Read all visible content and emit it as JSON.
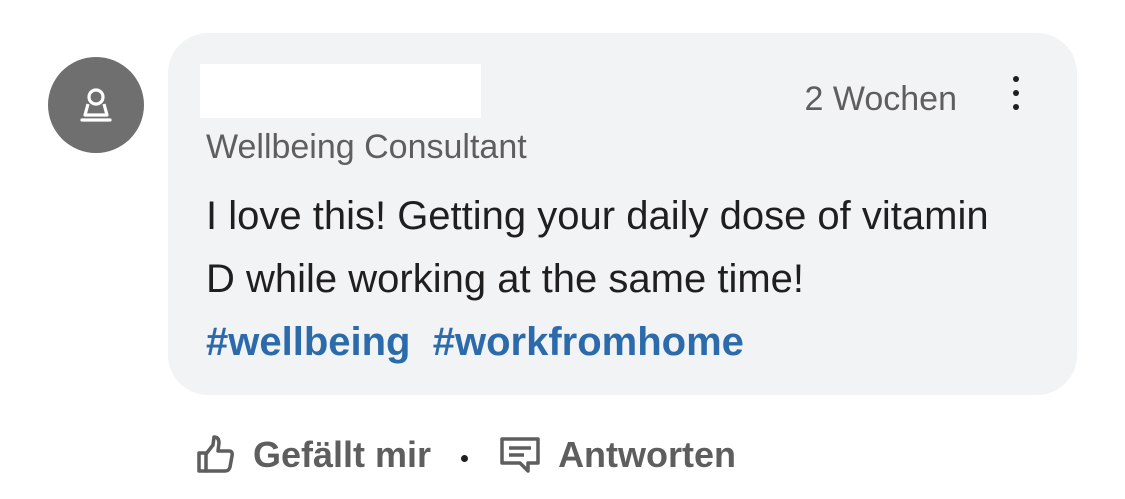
{
  "comment": {
    "author": {
      "avatar_icon": "person-icon",
      "headline": "Wellbeing Consultant"
    },
    "timestamp": "2 Wochen",
    "more_icon": "more-vertical-icon",
    "text_before": "I love this! Getting your daily dose of vitamin D while working at the same time! ",
    "hashtags": [
      "#wellbeing",
      "#workfromhome"
    ]
  },
  "actions": {
    "like": {
      "label": "Gefällt mir",
      "icon": "thumbs-up-icon"
    },
    "separator": "·",
    "reply": {
      "label": "Antworten",
      "icon": "comment-icon"
    }
  },
  "colors": {
    "bubble_bg": "#f2f3f5",
    "hashtag": "#2c6bab",
    "secondary_text": "#5e5e5e",
    "avatar_bg": "#6f6f6f"
  }
}
